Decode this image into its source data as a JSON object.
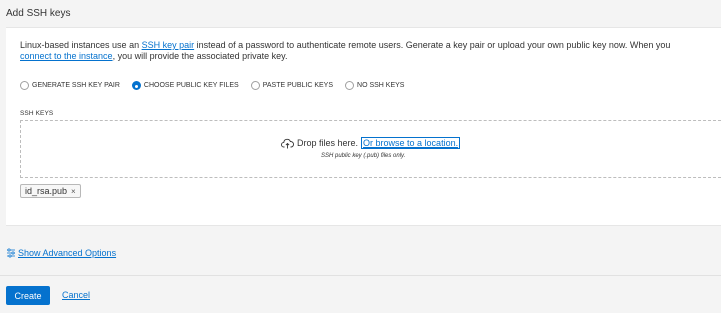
{
  "section": {
    "title": "Add SSH keys"
  },
  "intro": {
    "text_before": "Linux-based instances use an ",
    "link_ssh": "SSH key pair",
    "text_middle": " instead of a password to authenticate remote users. Generate a key pair or upload your own public key now. When you",
    "link_connect": "connect to the instance",
    "text_after": ", you will provide the associated private key."
  },
  "options": [
    {
      "label": "GENERATE SSH KEY PAIR",
      "selected": false
    },
    {
      "label": "CHOOSE PUBLIC KEY FILES",
      "selected": true
    },
    {
      "label": "PASTE PUBLIC KEYS",
      "selected": false
    },
    {
      "label": "NO SSH KEYS",
      "selected": false
    }
  ],
  "keys": {
    "label": "SSH KEYS",
    "drop_text": "Drop files here.",
    "browse_text": "Or browse to a location.",
    "hint": "SSH public key (.pub) files only.",
    "file_name": "id_rsa.pub",
    "remove_glyph": "×"
  },
  "advanced": {
    "label": "Show Advanced Options"
  },
  "footer": {
    "create_label": "Create",
    "cancel_label": "Cancel"
  },
  "colors": {
    "accent": "#0572ce",
    "background": "#f4f4f4",
    "panel": "#ffffff"
  }
}
